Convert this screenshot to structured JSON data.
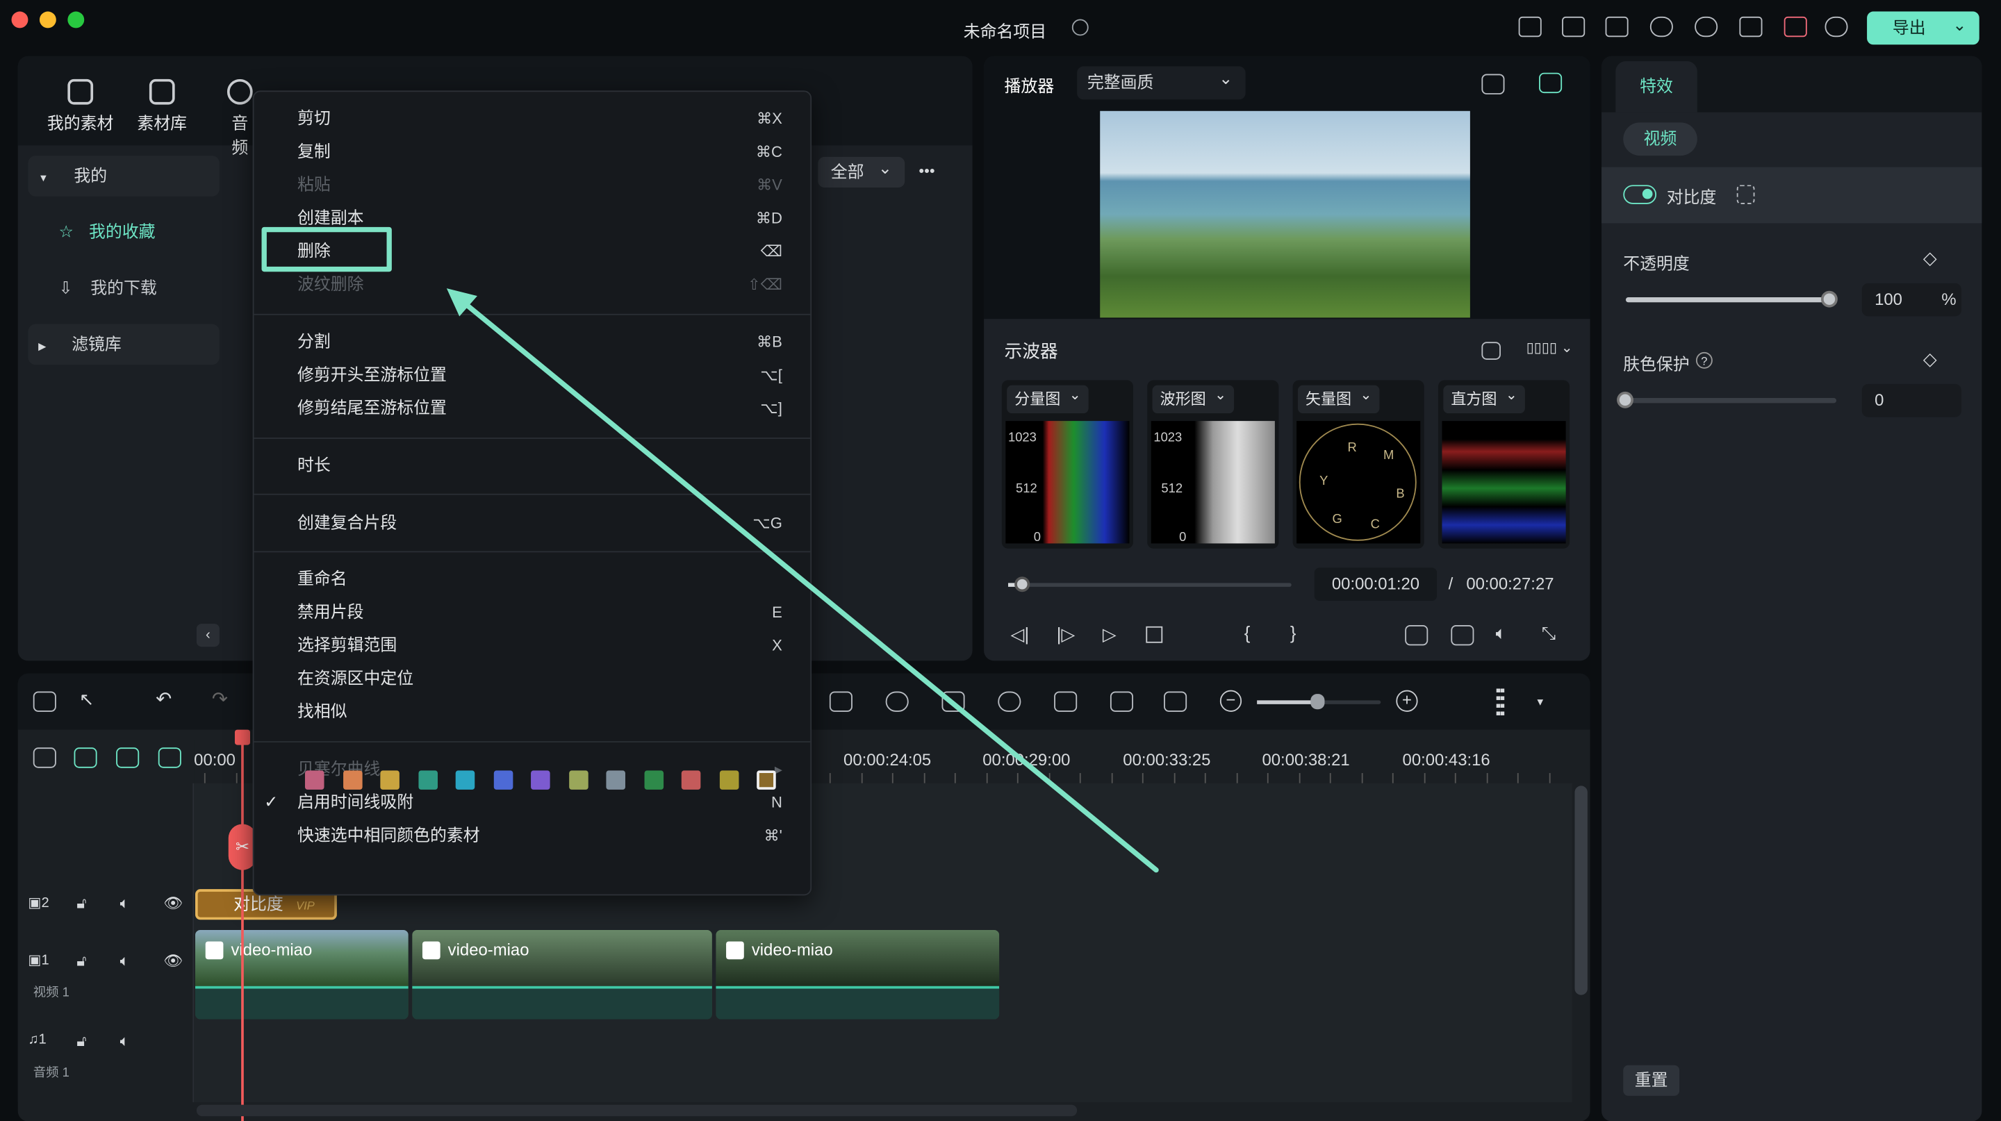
{
  "window": {
    "title": "未命名项目",
    "export_label": "导出"
  },
  "media_tabs": [
    {
      "label": "我的素材"
    },
    {
      "label": "素材库"
    },
    {
      "label": "音频"
    }
  ],
  "sidebar": {
    "items": [
      {
        "label": "我的",
        "icon": "triangle-down-icon"
      },
      {
        "label": "我的收藏",
        "icon": "star-icon",
        "active": true
      },
      {
        "label": "我的下载",
        "icon": "download-icon"
      },
      {
        "label": "滤镜库",
        "icon": "triangle-right-icon"
      }
    ]
  },
  "filter": {
    "selected": "全部",
    "more": "•••"
  },
  "context_menu": {
    "items": [
      {
        "label": "剪切",
        "shortcut": "⌘X"
      },
      {
        "label": "复制",
        "shortcut": "⌘C"
      },
      {
        "label": "粘贴",
        "shortcut": "⌘V",
        "disabled": true
      },
      {
        "label": "创建副本",
        "shortcut": "⌘D"
      },
      {
        "label": "删除",
        "shortcut": "⌫",
        "highlighted": true
      },
      {
        "label": "波纹删除",
        "shortcut": "⇧⌫",
        "disabled": true
      },
      {
        "label": "分割",
        "shortcut": "⌘B"
      },
      {
        "label": "修剪开头至游标位置",
        "shortcut": "⌥["
      },
      {
        "label": "修剪结尾至游标位置",
        "shortcut": "⌥]"
      },
      {
        "label": "时长",
        "shortcut": ""
      },
      {
        "label": "创建复合片段",
        "shortcut": "⌥G"
      },
      {
        "label": "重命名",
        "shortcut": ""
      },
      {
        "label": "禁用片段",
        "shortcut": "E"
      },
      {
        "label": "选择剪辑范围",
        "shortcut": "X"
      },
      {
        "label": "在资源区中定位",
        "shortcut": ""
      },
      {
        "label": "找相似",
        "shortcut": ""
      },
      {
        "label": "贝塞尔曲线",
        "shortcut": "▸",
        "disabled": true
      },
      {
        "label": "启用时间线吸附",
        "shortcut": "N",
        "checked": true
      },
      {
        "label": "快速选中相同颜色的素材",
        "shortcut": "⌘'"
      }
    ],
    "color_swatches": [
      "#c0607e",
      "#d98250",
      "#c9a43f",
      "#2f9a84",
      "#2aa5c3",
      "#4d6ad6",
      "#7c5bd0",
      "#9aa75a",
      "#7f8f9c",
      "#2e8a4a",
      "#c45b5b",
      "#a89a32",
      "#8a6a2a"
    ],
    "accent": "#7ee3c5"
  },
  "player": {
    "label": "播放器",
    "quality": "完整画质",
    "current_time": "00:00:01:20",
    "separator": "/",
    "total_time": "00:00:27:27",
    "progress": 0.05
  },
  "scopes": {
    "title": "示波器",
    "panels": [
      {
        "label": "分量图",
        "ticks": [
          "1023",
          "512",
          "0"
        ]
      },
      {
        "label": "波形图",
        "ticks": [
          "1023",
          "512",
          "0"
        ]
      },
      {
        "label": "矢量图",
        "marks": [
          "R",
          "M",
          "Y",
          "B",
          "G",
          "C"
        ]
      },
      {
        "label": "直方图"
      }
    ]
  },
  "effects": {
    "tab": "特效",
    "subtab": "视频",
    "effect_name": "对比度",
    "enabled": true,
    "opacity": {
      "label": "不透明度",
      "value": "100",
      "unit": "%",
      "fraction": 1.0
    },
    "skin": {
      "label": "肤色保护",
      "help": "?",
      "value": "0",
      "fraction": 0
    },
    "reset": "重置"
  },
  "timeline": {
    "ruler": [
      "00:00",
      "00:00:24:05",
      "00:00:29:00",
      "00:00:33:25",
      "00:00:38:21",
      "00:00:43:16"
    ],
    "zoom_level": 0.48,
    "tracks": [
      {
        "num": "2",
        "label": ""
      },
      {
        "num": "1",
        "label": "视频 1"
      },
      {
        "num": "1",
        "label": "音频 1"
      }
    ],
    "effect_clip": {
      "label": "对比度",
      "badge": "VIP"
    },
    "clips": [
      {
        "label": "video-miao"
      },
      {
        "label": "video-miao"
      },
      {
        "label": "video-miao"
      }
    ]
  }
}
